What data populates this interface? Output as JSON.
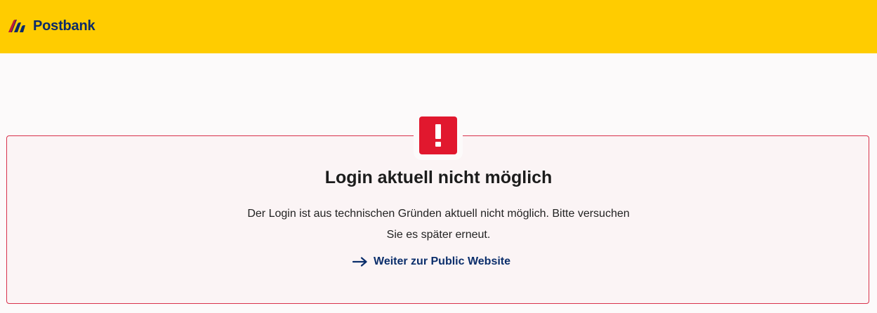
{
  "header": {
    "brand_name": "Postbank",
    "brand_color": "#ffcc00",
    "logo_icon": "postbank-logo-icon"
  },
  "alert": {
    "icon": "exclamation-icon",
    "accent_color": "#e1182e",
    "title": "Login aktuell nicht möglich",
    "message": "Der Login ist aus technischen Gründen aktuell nicht möglich. Bitte versuchen Sie es später erneut.",
    "link": {
      "icon": "arrow-right-icon",
      "label": "Weiter zur Public Website"
    }
  }
}
